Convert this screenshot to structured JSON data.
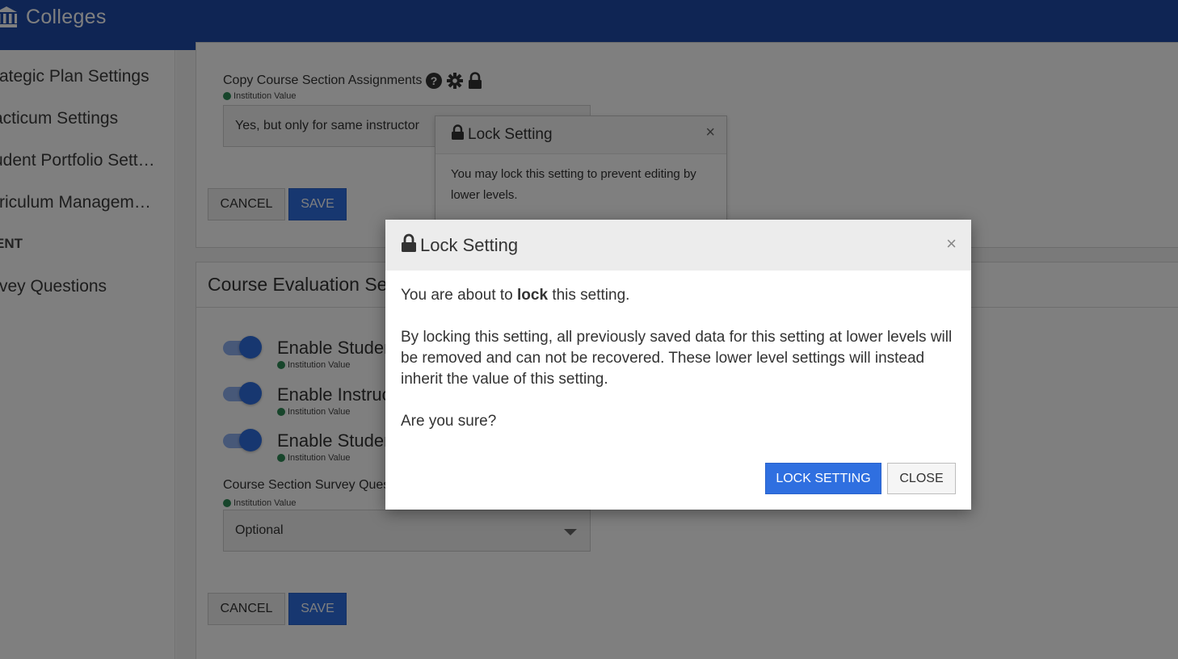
{
  "header": {
    "title": "Colleges",
    "icon": "institution-icon"
  },
  "sidebar": {
    "items": [
      {
        "label": "rategic Plan Settings"
      },
      {
        "label": "acticum Settings"
      },
      {
        "label": "udent Portfolio Sett…"
      },
      {
        "label": "rriculum Managem…"
      }
    ],
    "section_heading": "ENT",
    "items_after": [
      {
        "label": "rvey Questions"
      }
    ]
  },
  "copy_assignments": {
    "label": "Copy Course Section Assignments",
    "icons": [
      "help-icon",
      "gear-icon",
      "lock-icon"
    ],
    "source": "Institution Value",
    "value": "Yes, but only for same instructor"
  },
  "form_buttons": {
    "cancel": "CANCEL",
    "save": "SAVE"
  },
  "course_evaluation": {
    "title": "Course Evaluation Se",
    "toggles": [
      {
        "label": "Enable Studen",
        "source": "Institution Value",
        "on": true
      },
      {
        "label": "Enable Instruc",
        "source": "Institution Value",
        "on": true
      },
      {
        "label": "Enable Studen",
        "source": "Institution Value",
        "on": true
      }
    ],
    "survey_field": {
      "label": "Course Section Survey Quest",
      "source": "Institution Value",
      "value": "Optional"
    }
  },
  "popover": {
    "title": "Lock Setting",
    "close": "×",
    "text": "You may lock this setting to prevent editing by lower levels."
  },
  "modal": {
    "title": "Lock Setting",
    "close": "×",
    "line1_pre": "You are about to ",
    "line1_bold": "lock",
    "line1_post": " this setting.",
    "paragraph": "By locking this setting, all previously saved data for this setting at lower levels will be removed and can not be recovered. These lower level settings will instead inherit the value of this setting.",
    "question": "Are you sure?",
    "lock_button": "LOCK SETTING",
    "close_button": "CLOSE"
  },
  "colors": {
    "header": "#1f4aa8",
    "primary": "#2f6fe0",
    "status_dot": "#2e8b57"
  }
}
